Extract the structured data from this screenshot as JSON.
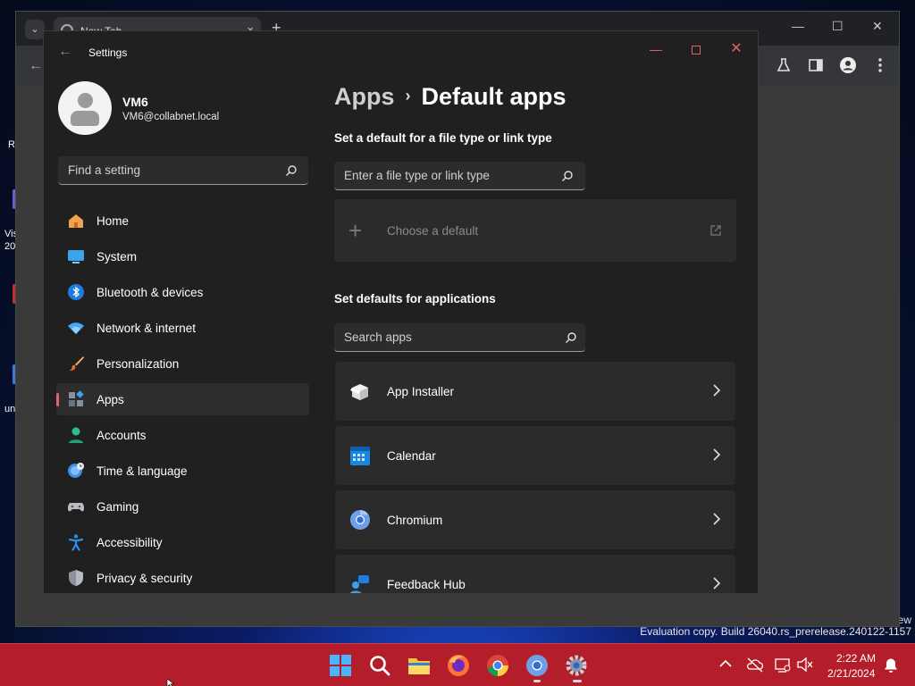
{
  "desktop": {
    "icon_labels": [
      "Re",
      "Vis",
      "20",
      "un"
    ],
    "watermark": "Evaluation copy. Build 26040.rs_prerelease.240122-1157",
    "watermark_tail": "ew"
  },
  "browser": {
    "tab_title": "New Tab",
    "tab_close": "×",
    "new_tab": "+",
    "tab_dropdown": "⌄",
    "minimize": "—",
    "maximize": "☐",
    "close": "✕"
  },
  "settings": {
    "title": "Settings",
    "back": "←",
    "window_minimize": "—",
    "window_close": "✕",
    "user": {
      "name": "VM6",
      "email": "VM6@collabnet.local"
    },
    "find_placeholder": "Find a setting",
    "nav": [
      {
        "label": "Home",
        "icon": "home-icon"
      },
      {
        "label": "System",
        "icon": "system-icon"
      },
      {
        "label": "Bluetooth & devices",
        "icon": "bluetooth-icon"
      },
      {
        "label": "Network & internet",
        "icon": "wifi-icon"
      },
      {
        "label": "Personalization",
        "icon": "brush-icon"
      },
      {
        "label": "Apps",
        "icon": "apps-icon",
        "selected": true
      },
      {
        "label": "Accounts",
        "icon": "accounts-icon"
      },
      {
        "label": "Time & language",
        "icon": "globe-clock-icon"
      },
      {
        "label": "Gaming",
        "icon": "gamepad-icon"
      },
      {
        "label": "Accessibility",
        "icon": "accessibility-icon"
      },
      {
        "label": "Privacy & security",
        "icon": "shield-icon"
      }
    ],
    "breadcrumb": {
      "parent": "Apps",
      "separator": "›",
      "current": "Default apps"
    },
    "filetype_section": {
      "title": "Set a default for a file type or link type",
      "placeholder": "Enter a file type or link type",
      "choose_plus": "+",
      "choose_label": "Choose a default"
    },
    "apps_section": {
      "title": "Set defaults for applications",
      "placeholder": "Search apps",
      "apps": [
        {
          "name": "App Installer",
          "icon": "app-installer-icon"
        },
        {
          "name": "Calendar",
          "icon": "calendar-icon"
        },
        {
          "name": "Chromium",
          "icon": "chromium-icon"
        },
        {
          "name": "Feedback Hub",
          "icon": "feedback-hub-icon"
        }
      ]
    }
  },
  "taskbar": {
    "apps": [
      "start",
      "search",
      "file-explorer",
      "firefox",
      "chrome",
      "chromium",
      "settings"
    ],
    "clock": {
      "time": "2:22 AM",
      "date": "2/21/2024"
    },
    "accent": "#b41e2a"
  },
  "colors": {
    "settings_bg": "#202020",
    "card_bg": "#2b2b2b",
    "accent": "#e0656b"
  }
}
